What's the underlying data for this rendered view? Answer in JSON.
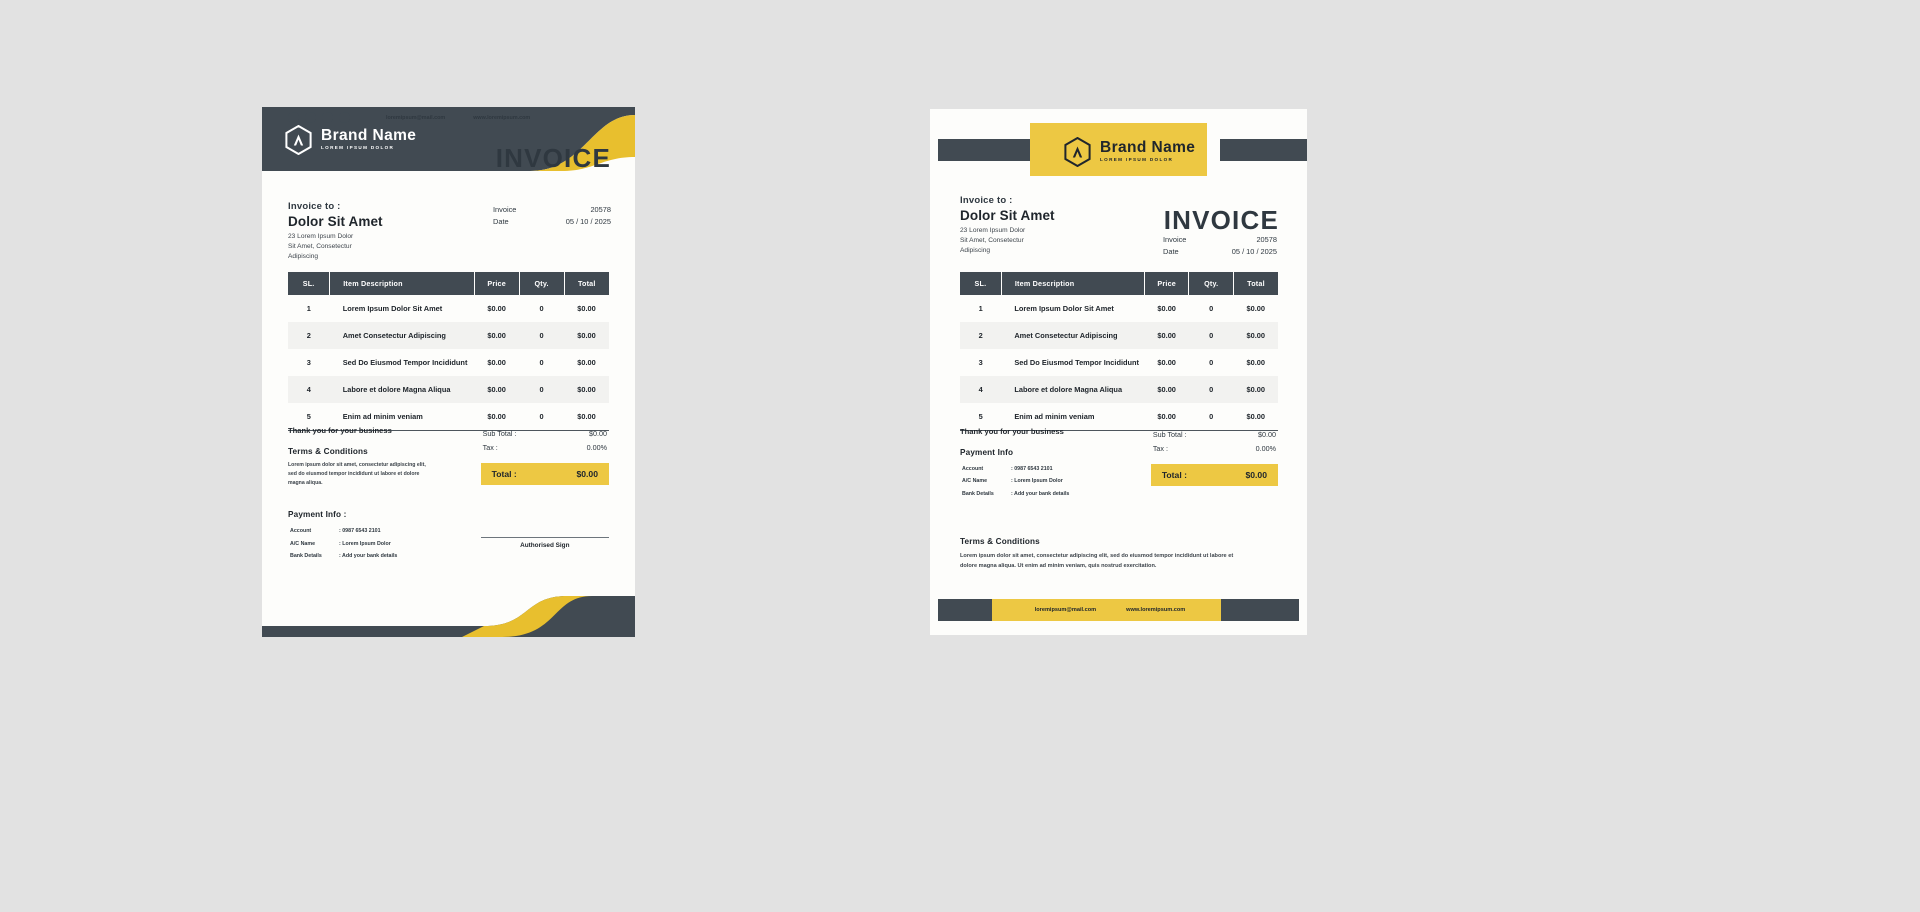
{
  "brand": {
    "name": "Brand Name",
    "tagline": "LOREM IPSUM DOLOR",
    "logo_icon": "hexagon-a-logo-icon"
  },
  "colors": {
    "dark": "#414a52",
    "yellow": "#edc843",
    "page_bg": "#e2e2e2",
    "sheet": "#fdfdfb"
  },
  "invoice": {
    "heading": "INVOICE",
    "bill_to_label": "Invoice to :",
    "client_name": "Dolor Sit Amet",
    "client_address_line1": "23 Lorem Ipsum Dolor",
    "client_address_line2": "Sit Amet, Consetectur",
    "client_address_line3": "Adipiscing",
    "meta": [
      {
        "label": "Invoice",
        "value": "20578"
      },
      {
        "label": "Date",
        "value": "05 / 10 / 2025"
      }
    ]
  },
  "table": {
    "headers": [
      "SL.",
      "Item Description",
      "Price",
      "Qty.",
      "Total"
    ],
    "rows": [
      {
        "sl": "1",
        "desc": "Lorem Ipsum Dolor Sit Amet",
        "price": "$0.00",
        "qty": "0",
        "total": "$0.00"
      },
      {
        "sl": "2",
        "desc": "Amet Consetectur Adipiscing",
        "price": "$0.00",
        "qty": "0",
        "total": "$0.00"
      },
      {
        "sl": "3",
        "desc": "Sed Do Eiusmod Tempor Incididunt",
        "price": "$0.00",
        "qty": "0",
        "total": "$0.00"
      },
      {
        "sl": "4",
        "desc": "Labore et dolore Magna Aliqua",
        "price": "$0.00",
        "qty": "0",
        "total": "$0.00"
      },
      {
        "sl": "5",
        "desc": "Enim ad minim veniam",
        "price": "$0.00",
        "qty": "0",
        "total": "$0.00"
      }
    ]
  },
  "summary": {
    "thanks": "Thank you for your business",
    "subtotal_label": "Sub Total :",
    "subtotal_value": "$0.00",
    "tax_label": "Tax :",
    "tax_value": "0.00%",
    "total_label": "Total :",
    "total_value": "$0.00"
  },
  "terms": {
    "title": "Terms & Conditions",
    "body_line1": "Lorem ipsum dolor sit amet, consectetur adipiscing elit,",
    "body_line2": "sed do eiusmod tempor incididunt ut labore et dolore",
    "body_line3": "magna aliqua.",
    "body_wide_line1": "Lorem ipsum dolor sit amet, consectetur adipiscing elit, sed do eiusmod tempor incididunt ut labore et",
    "body_wide_line2": "dolore magna aliqua. Ut enim ad minim veniam, quis nostrud exercitation."
  },
  "payment": {
    "title_1": "Payment Info :",
    "title_2": "Payment Info",
    "rows": [
      {
        "key": "Account",
        "value": ": 0987 6543 2101"
      },
      {
        "key": "A/C Name",
        "value": ": Lorem Ipsum Dolor"
      },
      {
        "key": "Bank Details",
        "value": ": Add your bank details"
      }
    ]
  },
  "signature": {
    "label": "Authorised Sign"
  },
  "footer": {
    "email": "loremipsum@mail.com",
    "website": "www.loremipsum.com",
    "social_icons": [
      "social-dot-icon",
      "social-dot-icon",
      "social-dot-icon",
      "social-dot-icon"
    ]
  }
}
